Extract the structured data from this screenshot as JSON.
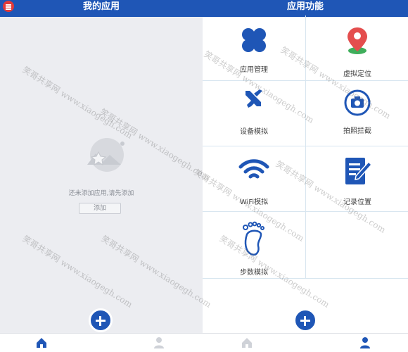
{
  "left": {
    "title": "我的应用",
    "empty_text": "还未添加应用,请先添加",
    "add_button": "添加"
  },
  "right": {
    "title": "应用功能",
    "features": [
      {
        "label": "应用管理",
        "icon": "clover-icon"
      },
      {
        "label": "虚拟定位",
        "icon": "location-pin-icon"
      },
      {
        "label": "设备模拟",
        "icon": "tools-icon"
      },
      {
        "label": "拍照拦截",
        "icon": "camera-icon"
      },
      {
        "label": "WiFi模拟",
        "icon": "wifi-icon"
      },
      {
        "label": "记录位置",
        "icon": "notepad-icon"
      },
      {
        "label": "步数模拟",
        "icon": "footprint-icon"
      }
    ]
  },
  "watermark": {
    "text": "笑哥共享网 www.xiaogegh.com"
  },
  "colors": {
    "primary": "#1f56b6",
    "danger": "#e23a3a",
    "pin": "#e44e4e",
    "pin_base": "#3fae5b"
  }
}
